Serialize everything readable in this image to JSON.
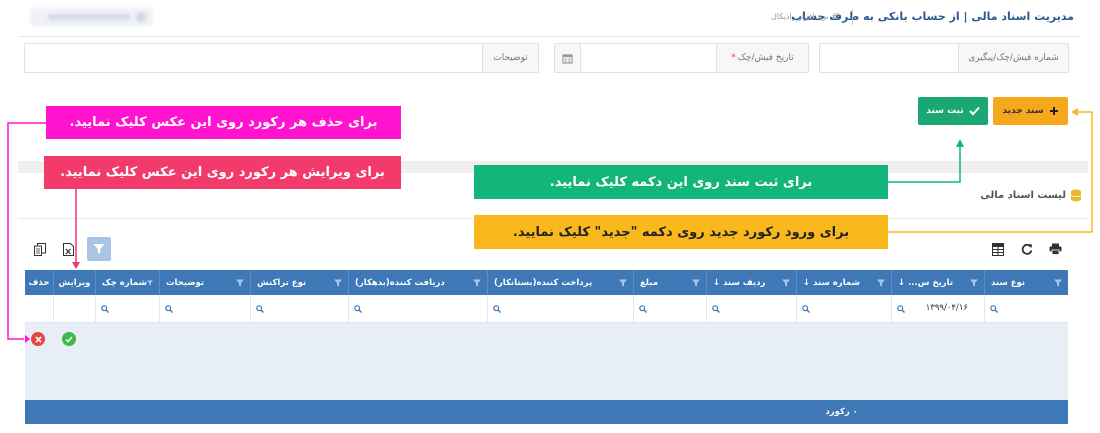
{
  "header": {
    "title": "مدیریت اسناد مالی | از حساب بانکی به طرف حساب",
    "breadcrumb": "# نرم افزار رادیکال"
  },
  "form": {
    "receipt_label": "شماره فیش/چک/پیگیری",
    "receipt_value": "",
    "date_label": "تاریخ فیش/چک",
    "date_required_mark": "*",
    "date_value": "",
    "desc_label": "توضیحات",
    "desc_value": ""
  },
  "buttons": {
    "new_doc": "سند جدید",
    "save_doc": "ثبت سند"
  },
  "list": {
    "title": "لیست اسناد مالی"
  },
  "grid": {
    "columns": [
      {
        "label": "نوع سند",
        "filter": true
      },
      {
        "label": "تاریخ س... ↓",
        "filter": true
      },
      {
        "label": "شماره سند ↓",
        "filter": true
      },
      {
        "label": "ردیف سند ↓",
        "filter": true
      },
      {
        "label": "مبلغ",
        "filter": true
      },
      {
        "label": "پرداخت کننده(بستانکار)",
        "filter": true
      },
      {
        "label": "دریافت کننده(بدهکار)",
        "filter": true
      },
      {
        "label": "نوع تراکنش",
        "filter": true
      },
      {
        "label": "توضیحات",
        "filter": true
      },
      {
        "label": "شماره چک",
        "filter": true
      },
      {
        "label": "ویرایش",
        "filter": false
      },
      {
        "label": "حذف",
        "filter": false
      }
    ],
    "filter_date_value": "۱۳۹۹/۰۴/۱۶",
    "footer": "۰ رکورد"
  },
  "annotations": {
    "delete_hint": "برای حذف هر رکورد روی این عکس کلیک نمایید.",
    "edit_hint": "برای ویرایش هر رکورد روی این عکس کلیک نمایید.",
    "save_hint": "برای ثبت سند روی این دکمه کلیک نمایید.",
    "new_hint": "برای ورود رکورد جدید روی دکمه \"جدید\" کلیک نمایید."
  },
  "colors": {
    "grid_header": "#3e78b6",
    "new_button": "#f6a81c",
    "save_button": "#1aa774",
    "pink_callout": "#ff13cf",
    "red_callout": "#f23a6b",
    "green_callout": "#13b57a",
    "yellow_callout": "#f9b81c"
  },
  "icons": [
    "calendar-icon",
    "check-icon",
    "plus-icon",
    "database-icon",
    "print-icon",
    "refresh-icon",
    "columns-icon",
    "filter-icon",
    "excel-icon",
    "copy-icon",
    "search-icon",
    "edit-icon",
    "delete-icon"
  ]
}
